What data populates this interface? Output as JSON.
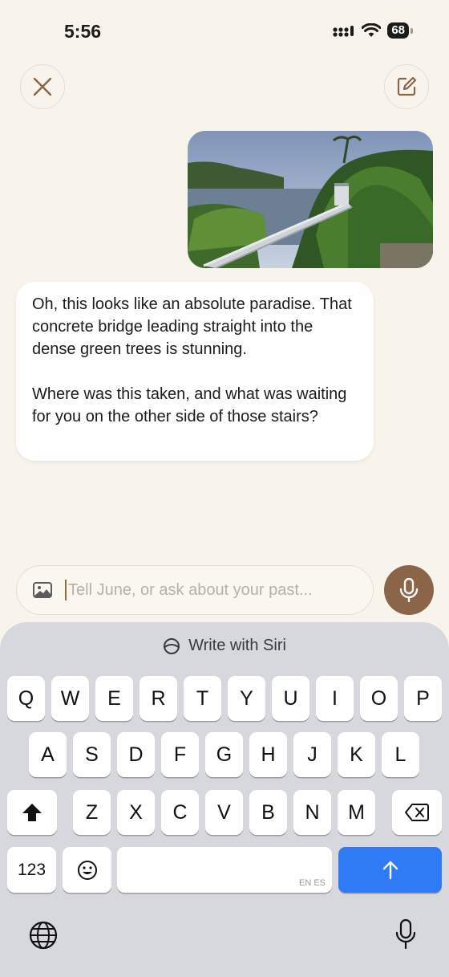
{
  "status": {
    "time": "5:56",
    "battery": "68"
  },
  "header": {
    "close_icon": "close-icon",
    "compose_icon": "compose-icon"
  },
  "message": {
    "paragraph1": "Oh, this looks like an absolute paradise. That concrete bridge leading straight into the dense green trees is stunning.",
    "paragraph2": "Where was this taken, and what was waiting for you on the other side of those stairs?"
  },
  "input": {
    "placeholder": "Tell June, or ask about your past..."
  },
  "keyboard": {
    "siri_label": "Write with Siri",
    "row1": [
      "Q",
      "W",
      "E",
      "R",
      "T",
      "Y",
      "U",
      "I",
      "O",
      "P"
    ],
    "row2": [
      "A",
      "S",
      "D",
      "F",
      "G",
      "H",
      "J",
      "K",
      "L"
    ],
    "row3": [
      "Z",
      "X",
      "C",
      "V",
      "B",
      "N",
      "M"
    ],
    "numbers_label": "123",
    "language_tag": "EN ES"
  },
  "colors": {
    "accent": "#8a6548",
    "background": "#f8f4ec",
    "send": "#2f7bf5"
  }
}
